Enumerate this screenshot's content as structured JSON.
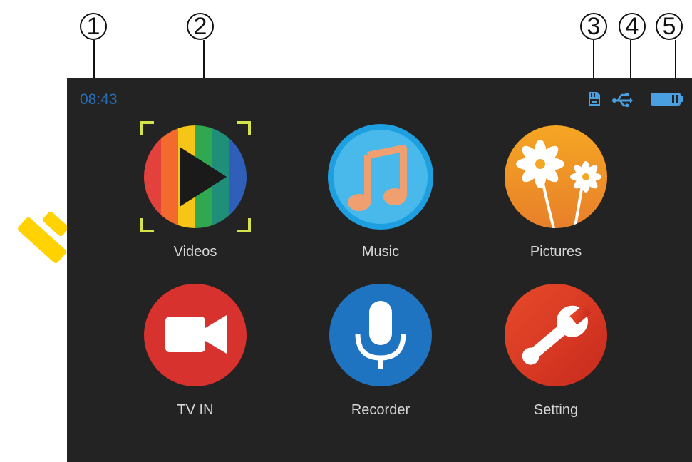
{
  "callouts": [
    "1",
    "2",
    "3",
    "4",
    "5"
  ],
  "status": {
    "clock": "08:43",
    "icons": [
      "sd-card-icon",
      "usb-icon",
      "battery-icon"
    ]
  },
  "menu": [
    {
      "label": "Videos",
      "icon": "video-play-icon",
      "selected": true
    },
    {
      "label": "Music",
      "icon": "music-note-icon"
    },
    {
      "label": "Pictures",
      "icon": "flower-icon"
    },
    {
      "label": "TV IN",
      "icon": "camera-icon"
    },
    {
      "label": "Recorder",
      "icon": "microphone-icon"
    },
    {
      "label": "Setting",
      "icon": "wrench-icon"
    }
  ],
  "colors": {
    "screen_bg": "#232323",
    "clock": "#2a6fb5",
    "status_icons": "#4a9fe0",
    "selection_corners": "#d4e34a",
    "watermark": "#ffd200"
  }
}
